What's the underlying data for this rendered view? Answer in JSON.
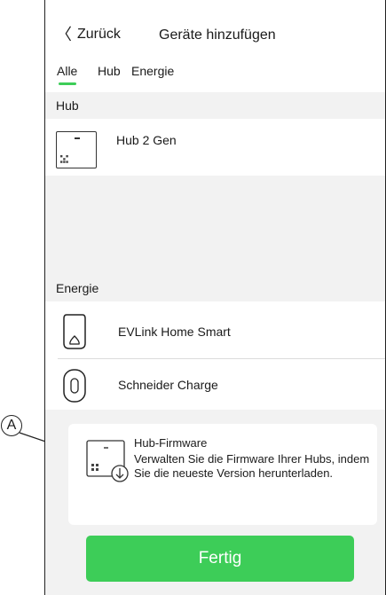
{
  "nav": {
    "back_label": "Zurück",
    "title": "Geräte hinzufügen"
  },
  "tabs": [
    {
      "label": "Alle",
      "active": true
    },
    {
      "label": "Hub",
      "active": false
    },
    {
      "label": "Energie",
      "active": false
    }
  ],
  "accent_color": "#3dcd58",
  "sections": {
    "hub": {
      "header": "Hub",
      "items": [
        {
          "label": "Hub 2 Gen",
          "icon": "hub-qr-icon"
        }
      ]
    },
    "energie": {
      "header": "Energie",
      "items": [
        {
          "label": "EVLink Home Smart",
          "icon": "evlink-charger-icon"
        },
        {
          "label": "Schneider Charge",
          "icon": "schneider-charger-icon"
        }
      ]
    }
  },
  "firmware": {
    "title": "Hub-Firmware",
    "description": "Verwalten Sie die Firmware Ihrer Hubs, indem Sie die neueste Version herunterladen.",
    "icon": "hub-firmware-download-icon"
  },
  "done_button": "Fertig",
  "callout_label": "A"
}
